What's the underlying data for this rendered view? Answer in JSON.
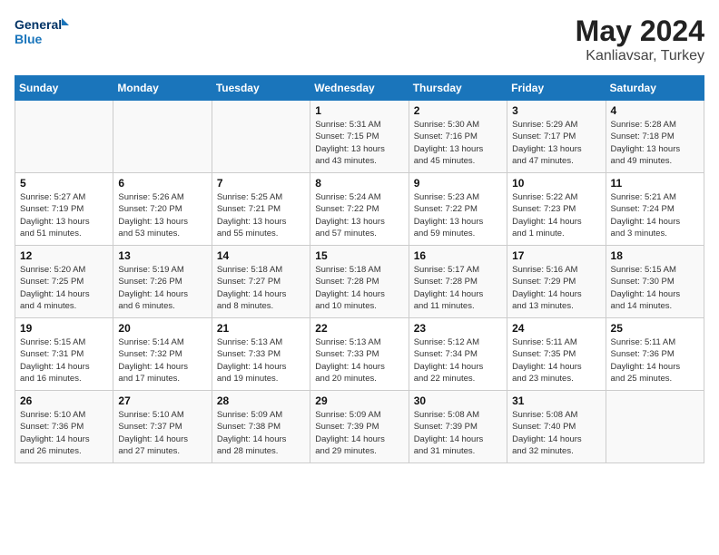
{
  "header": {
    "logo_line1": "General",
    "logo_line2": "Blue",
    "title": "May 2024",
    "subtitle": "Kanliavsar, Turkey"
  },
  "weekdays": [
    "Sunday",
    "Monday",
    "Tuesday",
    "Wednesday",
    "Thursday",
    "Friday",
    "Saturday"
  ],
  "weeks": [
    [
      {
        "day": "",
        "info": ""
      },
      {
        "day": "",
        "info": ""
      },
      {
        "day": "",
        "info": ""
      },
      {
        "day": "1",
        "info": "Sunrise: 5:31 AM\nSunset: 7:15 PM\nDaylight: 13 hours\nand 43 minutes."
      },
      {
        "day": "2",
        "info": "Sunrise: 5:30 AM\nSunset: 7:16 PM\nDaylight: 13 hours\nand 45 minutes."
      },
      {
        "day": "3",
        "info": "Sunrise: 5:29 AM\nSunset: 7:17 PM\nDaylight: 13 hours\nand 47 minutes."
      },
      {
        "day": "4",
        "info": "Sunrise: 5:28 AM\nSunset: 7:18 PM\nDaylight: 13 hours\nand 49 minutes."
      }
    ],
    [
      {
        "day": "5",
        "info": "Sunrise: 5:27 AM\nSunset: 7:19 PM\nDaylight: 13 hours\nand 51 minutes."
      },
      {
        "day": "6",
        "info": "Sunrise: 5:26 AM\nSunset: 7:20 PM\nDaylight: 13 hours\nand 53 minutes."
      },
      {
        "day": "7",
        "info": "Sunrise: 5:25 AM\nSunset: 7:21 PM\nDaylight: 13 hours\nand 55 minutes."
      },
      {
        "day": "8",
        "info": "Sunrise: 5:24 AM\nSunset: 7:22 PM\nDaylight: 13 hours\nand 57 minutes."
      },
      {
        "day": "9",
        "info": "Sunrise: 5:23 AM\nSunset: 7:22 PM\nDaylight: 13 hours\nand 59 minutes."
      },
      {
        "day": "10",
        "info": "Sunrise: 5:22 AM\nSunset: 7:23 PM\nDaylight: 14 hours\nand 1 minute."
      },
      {
        "day": "11",
        "info": "Sunrise: 5:21 AM\nSunset: 7:24 PM\nDaylight: 14 hours\nand 3 minutes."
      }
    ],
    [
      {
        "day": "12",
        "info": "Sunrise: 5:20 AM\nSunset: 7:25 PM\nDaylight: 14 hours\nand 4 minutes."
      },
      {
        "day": "13",
        "info": "Sunrise: 5:19 AM\nSunset: 7:26 PM\nDaylight: 14 hours\nand 6 minutes."
      },
      {
        "day": "14",
        "info": "Sunrise: 5:18 AM\nSunset: 7:27 PM\nDaylight: 14 hours\nand 8 minutes."
      },
      {
        "day": "15",
        "info": "Sunrise: 5:18 AM\nSunset: 7:28 PM\nDaylight: 14 hours\nand 10 minutes."
      },
      {
        "day": "16",
        "info": "Sunrise: 5:17 AM\nSunset: 7:28 PM\nDaylight: 14 hours\nand 11 minutes."
      },
      {
        "day": "17",
        "info": "Sunrise: 5:16 AM\nSunset: 7:29 PM\nDaylight: 14 hours\nand 13 minutes."
      },
      {
        "day": "18",
        "info": "Sunrise: 5:15 AM\nSunset: 7:30 PM\nDaylight: 14 hours\nand 14 minutes."
      }
    ],
    [
      {
        "day": "19",
        "info": "Sunrise: 5:15 AM\nSunset: 7:31 PM\nDaylight: 14 hours\nand 16 minutes."
      },
      {
        "day": "20",
        "info": "Sunrise: 5:14 AM\nSunset: 7:32 PM\nDaylight: 14 hours\nand 17 minutes."
      },
      {
        "day": "21",
        "info": "Sunrise: 5:13 AM\nSunset: 7:33 PM\nDaylight: 14 hours\nand 19 minutes."
      },
      {
        "day": "22",
        "info": "Sunrise: 5:13 AM\nSunset: 7:33 PM\nDaylight: 14 hours\nand 20 minutes."
      },
      {
        "day": "23",
        "info": "Sunrise: 5:12 AM\nSunset: 7:34 PM\nDaylight: 14 hours\nand 22 minutes."
      },
      {
        "day": "24",
        "info": "Sunrise: 5:11 AM\nSunset: 7:35 PM\nDaylight: 14 hours\nand 23 minutes."
      },
      {
        "day": "25",
        "info": "Sunrise: 5:11 AM\nSunset: 7:36 PM\nDaylight: 14 hours\nand 25 minutes."
      }
    ],
    [
      {
        "day": "26",
        "info": "Sunrise: 5:10 AM\nSunset: 7:36 PM\nDaylight: 14 hours\nand 26 minutes."
      },
      {
        "day": "27",
        "info": "Sunrise: 5:10 AM\nSunset: 7:37 PM\nDaylight: 14 hours\nand 27 minutes."
      },
      {
        "day": "28",
        "info": "Sunrise: 5:09 AM\nSunset: 7:38 PM\nDaylight: 14 hours\nand 28 minutes."
      },
      {
        "day": "29",
        "info": "Sunrise: 5:09 AM\nSunset: 7:39 PM\nDaylight: 14 hours\nand 29 minutes."
      },
      {
        "day": "30",
        "info": "Sunrise: 5:08 AM\nSunset: 7:39 PM\nDaylight: 14 hours\nand 31 minutes."
      },
      {
        "day": "31",
        "info": "Sunrise: 5:08 AM\nSunset: 7:40 PM\nDaylight: 14 hours\nand 32 minutes."
      },
      {
        "day": "",
        "info": ""
      }
    ]
  ]
}
